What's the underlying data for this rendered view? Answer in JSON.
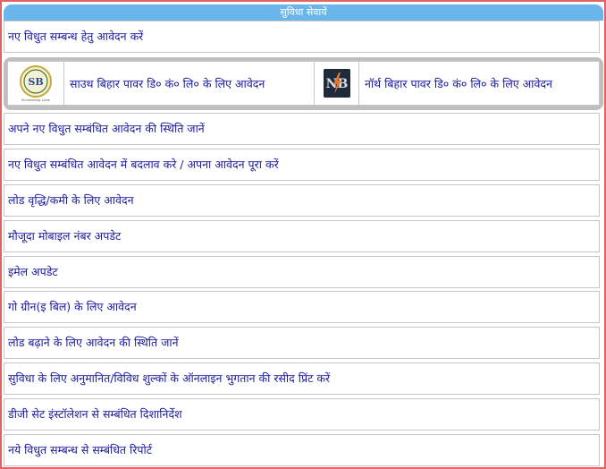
{
  "header": {
    "title": "सुविधा सेवायें"
  },
  "new_connection": {
    "label": "नए विधुत सम्बन्ध हेतु आवेदन करें"
  },
  "discoms": {
    "south": {
      "label": "साउथ बिहार पावर डि० कं० लि० के लिए आवेदन",
      "logo_text": "SB",
      "logo_caption": "Illuminating Lives"
    },
    "north": {
      "label": "नॉर्थ बिहार पावर डि० कं० लि० के लिए आवेदन",
      "logo_text": "NB"
    }
  },
  "services": [
    "अपने नए विधुत सम्बंधित आवेदन की स्थिति जानें",
    "नए विधुत सम्बंधित आवेदन में बदलाव करे / अपना आवेदन पूरा करें",
    "लोड वृद्धि/कमी के लिए आवेदन",
    "मौजूदा मोबाइल नंबर अपडेट",
    "इमेल अपडेट",
    "गो ग्रीन(इ बिल) के लिए आवेदन",
    "लोड बढ़ाने के लिए आवेदन की स्थिति जानें",
    "सुविधा के लिए अनुमानित/विविध शुल्कों के ऑनलाइन भुगतान की रसीद प्रिंट करें",
    "डीजी सेट इंस्टॉलेशन से सम्बंधित दिशानिर्देश",
    "नये विधुत सम्बन्ध से सम्बंधित रिपोर्ट"
  ],
  "colors": {
    "header_bg": "#6ab6ea",
    "link_text": "#1a1a9c",
    "frame_border": "#e06464",
    "discom_bg": "#bfbfbf"
  }
}
